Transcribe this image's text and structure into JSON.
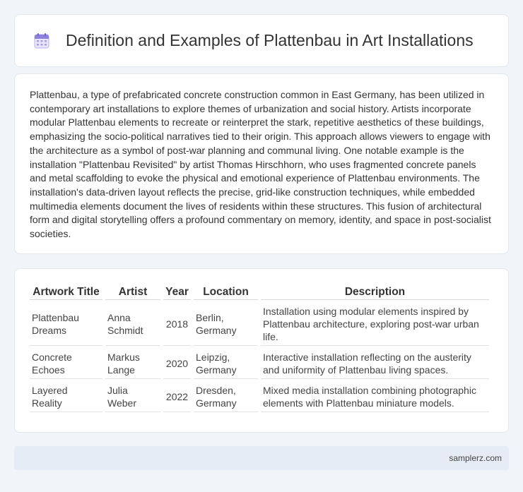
{
  "header": {
    "icon": "calendar-icon",
    "title": "Definition and Examples of Plattenbau in Art Installations"
  },
  "intro": {
    "text": "Plattenbau, a type of prefabricated concrete construction common in East Germany, has been utilized in contemporary art installations to explore themes of urbanization and social history. Artists incorporate modular Plattenbau elements to recreate or reinterpret the stark, repetitive aesthetics of these buildings, emphasizing the socio-political narratives tied to their origin. This approach allows viewers to engage with the architecture as a symbol of post-war planning and communal living. One notable example is the installation \"Plattenbau Revisited\" by artist Thomas Hirschhorn, who uses fragmented concrete panels and metal scaffolding to evoke the physical and emotional experience of Plattenbau environments. The installation's data-driven layout reflects the precise, grid-like construction techniques, while embedded multimedia elements document the lives of residents within these structures. This fusion of architectural form and digital storytelling offers a profound commentary on memory, identity, and space in post-socialist societies."
  },
  "table": {
    "headers": [
      "Artwork Title",
      "Artist",
      "Year",
      "Location",
      "Description"
    ],
    "rows": [
      [
        "Plattenbau Dreams",
        "Anna Schmidt",
        "2018",
        "Berlin, Germany",
        "Installation using modular elements inspired by Plattenbau architecture, exploring post-war urban life."
      ],
      [
        "Concrete Echoes",
        "Markus Lange",
        "2020",
        "Leipzig, Germany",
        "Interactive installation reflecting on the austerity and uniformity of Plattenbau living spaces."
      ],
      [
        "Layered Reality",
        "Julia Weber",
        "2022",
        "Dresden, Germany",
        "Mixed media installation combining photographic elements with Plattenbau miniature models."
      ]
    ]
  },
  "footer": {
    "text": "samplerz.com"
  },
  "colors": {
    "background": "#f1f5fa",
    "footer_bg": "#e6ecf5",
    "icon_accent": "#7b6fd6"
  }
}
